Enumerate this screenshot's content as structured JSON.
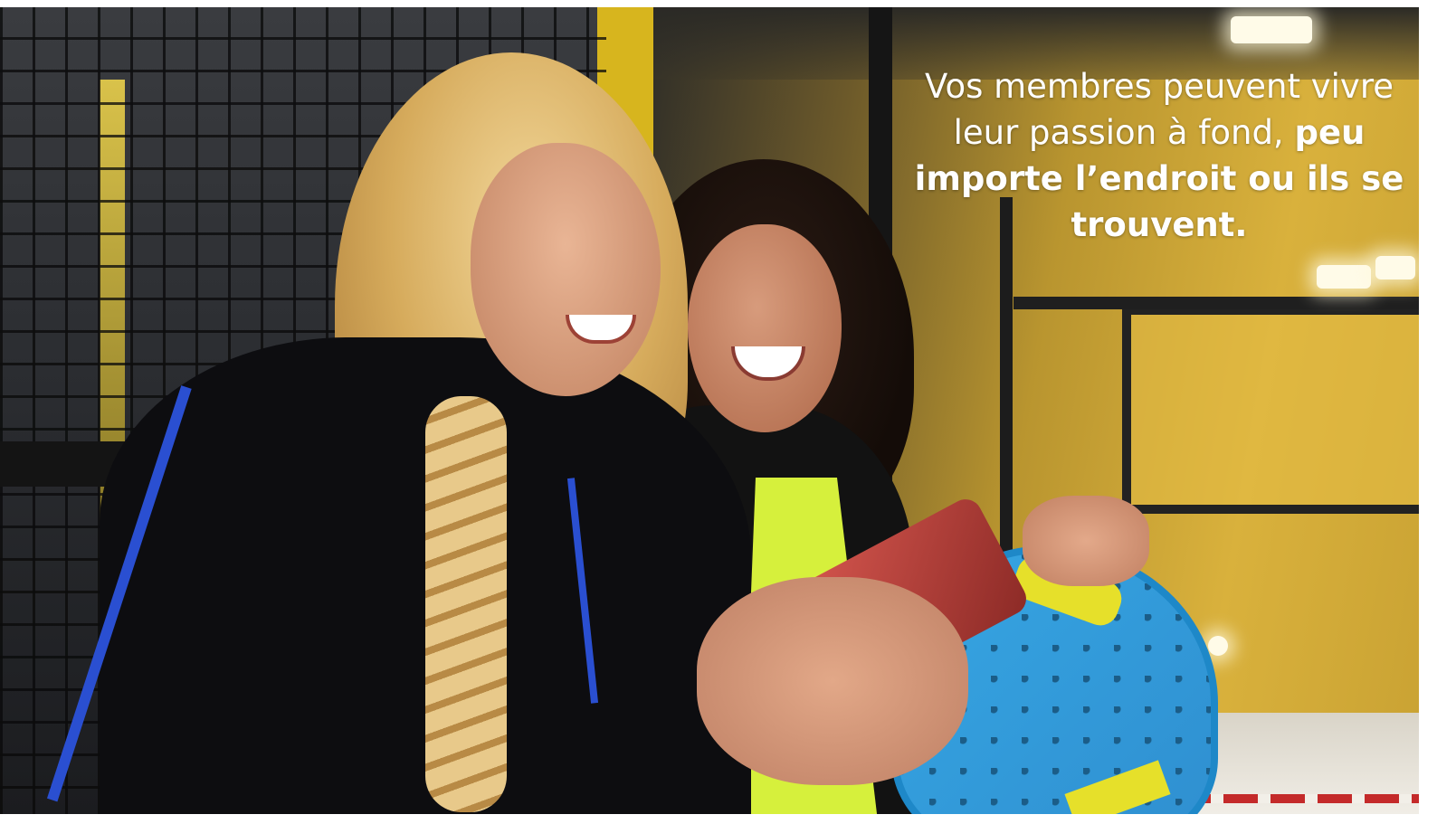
{
  "caption": {
    "regular_text": "Vos membres peuvent vivre leur passion à fond,",
    "bold_text": "peu importe l’endroit ou ils se trouvent."
  },
  "photo": {
    "colors": {
      "court_yellow": "#d9b13c",
      "mesh_dark": "#1b1c1f",
      "racket_blue": "#36a6e3",
      "phone_red": "#d3554d"
    }
  }
}
